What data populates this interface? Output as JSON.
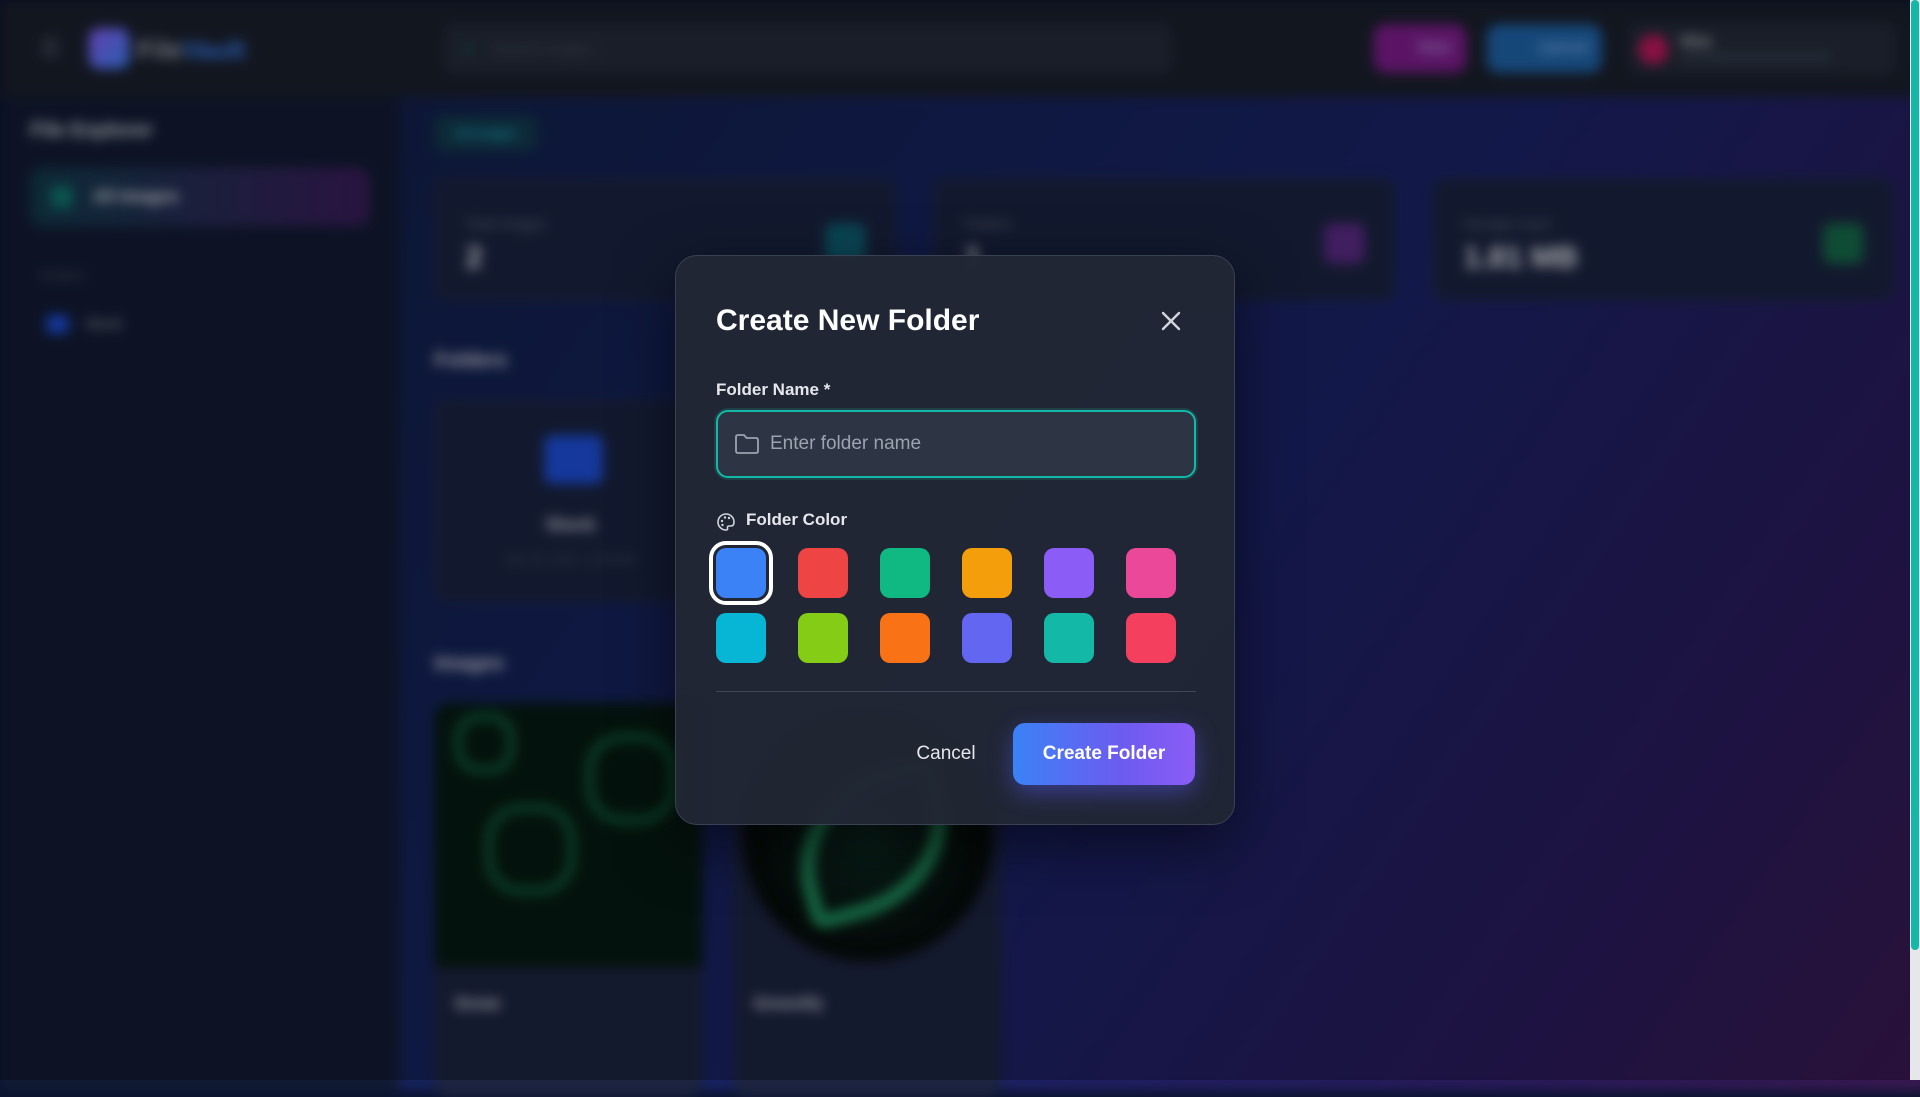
{
  "app": {
    "logo_text_a": "File",
    "logo_text_b": "Vault",
    "search_placeholder": "Search images...",
    "new_label": "New",
    "upload_label": "Upload",
    "user_name": "Nina"
  },
  "sidebar": {
    "title": "File Explorer",
    "all_images_label": "All Images",
    "folders_heading": "Folders",
    "folder_item": "Stock"
  },
  "main": {
    "breadcrumb": "All Images",
    "stats": [
      {
        "label": "Total Images",
        "value": "2"
      },
      {
        "label": "Folders",
        "value": "1"
      },
      {
        "label": "Storage Used",
        "value": "1.81 MB"
      }
    ],
    "folders_title": "Folders",
    "folder_card": {
      "name": "Stock",
      "date": "Sep 28, 2025, 10:00 AM"
    },
    "images_title": "Images",
    "images": [
      {
        "name": "Snow"
      },
      {
        "name": "Greenify"
      }
    ]
  },
  "modal": {
    "title": "Create New Folder",
    "name_label": "Folder Name *",
    "name_placeholder": "Enter folder name",
    "name_value": "",
    "color_label": "Folder Color",
    "colors": [
      "#3b82f6",
      "#ef4444",
      "#10b981",
      "#f59e0b",
      "#8b5cf6",
      "#ec4899",
      "#06b6d4",
      "#84cc16",
      "#f97316",
      "#6366f1",
      "#14b8a6",
      "#f43f5e"
    ],
    "selected_color": "#3b82f6",
    "cancel_label": "Cancel",
    "create_label": "Create Folder"
  },
  "icons": {
    "close": "close-icon",
    "folder": "folder-icon",
    "palette": "palette-icon"
  }
}
